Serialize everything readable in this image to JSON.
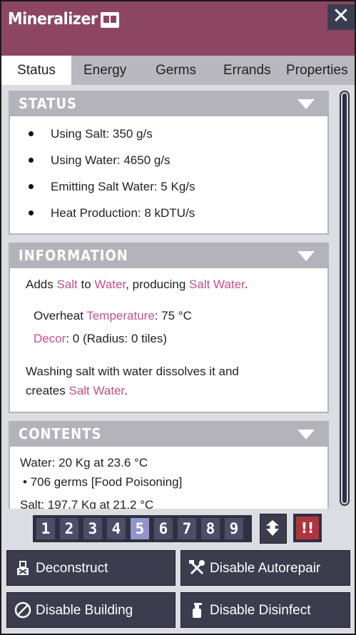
{
  "window": {
    "title": "Mineralizer",
    "close_label": "✕"
  },
  "tabs": [
    "Status",
    "Energy",
    "Germs",
    "Errands",
    "Properties"
  ],
  "status": {
    "header": "STATUS",
    "items": [
      "Using Salt: 350 g/s",
      "Using Water: 4650 g/s",
      "Emitting Salt Water: 5 Kg/s",
      "Heat Production: 8 kDTU/s"
    ]
  },
  "information": {
    "header": "INFORMATION",
    "desc": {
      "a": "Adds ",
      "salt": "Salt",
      "b": " to ",
      "water": "Water",
      "c": ", producing ",
      "salt_water": "Salt Water",
      "d": "."
    },
    "overheat": {
      "prefix": "Overheat ",
      "link": "Temperature",
      "value": ": 75 °C"
    },
    "decor": {
      "link": "Decor",
      "value": ": 0 (Radius: 0 tiles)"
    },
    "flavor_line1": "Washing salt with water dissolves it and",
    "flavor_line2_prefix": "creates ",
    "flavor_line2_link": "Salt Water",
    "flavor_line2_suffix": "."
  },
  "contents": {
    "header": "CONTENTS",
    "lines": [
      "Water: 20 Kg at 23.6 °C",
      "• 706 germs [Food Poisoning]",
      "Salt: 197.7 Kg at 21.2 °C"
    ]
  },
  "priority": {
    "values": [
      "1",
      "2",
      "3",
      "4",
      "5",
      "6",
      "7",
      "8",
      "9"
    ],
    "selected": 5,
    "alert_label": "!!"
  },
  "actions": {
    "deconstruct": "Deconstruct",
    "disable_autorepair": "Disable Autorepair",
    "disable_building": "Disable Building",
    "disable_disinfect": "Disable Disinfect"
  },
  "colors": {
    "title_bar": "#8c4661",
    "link": "#c0508a",
    "priority_selected": "#8f94c9",
    "alert": "#b2333d"
  },
  "icons": {
    "book": "codex-book-icon",
    "close": "close-icon",
    "deconstruct": "deconstruct-icon",
    "autorepair": "wrench-hammer-icon",
    "disable": "prohibit-icon",
    "disinfect": "spray-bottle-icon",
    "swap": "up-down-arrow-icon"
  }
}
